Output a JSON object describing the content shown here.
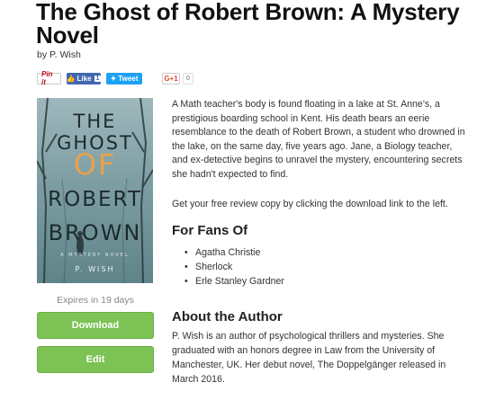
{
  "book": {
    "title": "The Ghost of Robert Brown: A Mystery Novel",
    "author_line": "by P. Wish"
  },
  "share": {
    "pin_label": "Pin it",
    "fb_label": "Like",
    "fb_count": "1",
    "tw_label": "Tweet",
    "gplus_label": "G+1",
    "gplus_count": "0"
  },
  "cover": {
    "line1": "THE GHOST",
    "line2": "OF",
    "line3": "ROBERT",
    "line4": "BROWN",
    "subtitle": "A MYSTERY NOVEL",
    "author": "P. WISH"
  },
  "sidebar": {
    "expires": "Expires in 19 days",
    "download_label": "Download",
    "edit_label": "Edit"
  },
  "main": {
    "description": "A Math teacher's body is found floating in a lake at St. Anne's, a prestigious boarding school in Kent. His death bears an eerie resemblance to the death of Robert Brown, a student who drowned in the lake, on the same day, five years ago. Jane, a Biology teacher, and ex-detective begins to unravel the mystery, encountering secrets she hadn't expected to find.",
    "review_copy": "Get your free review copy by clicking the download link to the left.",
    "fans_heading": "For Fans Of",
    "fans": [
      "Agatha Christie",
      "Sherlock",
      "Erle Stanley Gardner"
    ],
    "about_heading": "About the Author",
    "about_text": "P. Wish is an author of psychological thrillers and mysteries. She graduated with an honors degree in Law from the University of Manchester, UK. Her debut novel, The Doppelgänger released in March 2016."
  },
  "colors": {
    "button_green": "#7cc254",
    "facebook": "#4267b2",
    "twitter": "#1da1f2",
    "cover_accent": "#eaa24a"
  }
}
